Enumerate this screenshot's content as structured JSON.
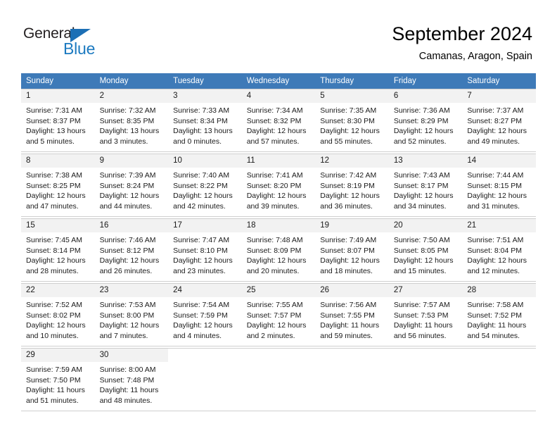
{
  "brand": {
    "name_part1": "General",
    "name_part2": "Blue",
    "triangle_color": "#1c6fb5",
    "blue_color": "#1c7ac0"
  },
  "header": {
    "title": "September 2024",
    "subtitle": "Camanas, Aragon, Spain"
  },
  "theme": {
    "header_bg": "#3e7ab8",
    "header_text": "#ffffff",
    "daynum_bg": "#f2f2f2",
    "grid_line": "#cfcfcf"
  },
  "weekday_headers": [
    "Sunday",
    "Monday",
    "Tuesday",
    "Wednesday",
    "Thursday",
    "Friday",
    "Saturday"
  ],
  "weeks": [
    [
      {
        "day": "1",
        "sunrise": "Sunrise: 7:31 AM",
        "sunset": "Sunset: 8:37 PM",
        "daylight1": "Daylight: 13 hours",
        "daylight2": "and 5 minutes."
      },
      {
        "day": "2",
        "sunrise": "Sunrise: 7:32 AM",
        "sunset": "Sunset: 8:35 PM",
        "daylight1": "Daylight: 13 hours",
        "daylight2": "and 3 minutes."
      },
      {
        "day": "3",
        "sunrise": "Sunrise: 7:33 AM",
        "sunset": "Sunset: 8:34 PM",
        "daylight1": "Daylight: 13 hours",
        "daylight2": "and 0 minutes."
      },
      {
        "day": "4",
        "sunrise": "Sunrise: 7:34 AM",
        "sunset": "Sunset: 8:32 PM",
        "daylight1": "Daylight: 12 hours",
        "daylight2": "and 57 minutes."
      },
      {
        "day": "5",
        "sunrise": "Sunrise: 7:35 AM",
        "sunset": "Sunset: 8:30 PM",
        "daylight1": "Daylight: 12 hours",
        "daylight2": "and 55 minutes."
      },
      {
        "day": "6",
        "sunrise": "Sunrise: 7:36 AM",
        "sunset": "Sunset: 8:29 PM",
        "daylight1": "Daylight: 12 hours",
        "daylight2": "and 52 minutes."
      },
      {
        "day": "7",
        "sunrise": "Sunrise: 7:37 AM",
        "sunset": "Sunset: 8:27 PM",
        "daylight1": "Daylight: 12 hours",
        "daylight2": "and 49 minutes."
      }
    ],
    [
      {
        "day": "8",
        "sunrise": "Sunrise: 7:38 AM",
        "sunset": "Sunset: 8:25 PM",
        "daylight1": "Daylight: 12 hours",
        "daylight2": "and 47 minutes."
      },
      {
        "day": "9",
        "sunrise": "Sunrise: 7:39 AM",
        "sunset": "Sunset: 8:24 PM",
        "daylight1": "Daylight: 12 hours",
        "daylight2": "and 44 minutes."
      },
      {
        "day": "10",
        "sunrise": "Sunrise: 7:40 AM",
        "sunset": "Sunset: 8:22 PM",
        "daylight1": "Daylight: 12 hours",
        "daylight2": "and 42 minutes."
      },
      {
        "day": "11",
        "sunrise": "Sunrise: 7:41 AM",
        "sunset": "Sunset: 8:20 PM",
        "daylight1": "Daylight: 12 hours",
        "daylight2": "and 39 minutes."
      },
      {
        "day": "12",
        "sunrise": "Sunrise: 7:42 AM",
        "sunset": "Sunset: 8:19 PM",
        "daylight1": "Daylight: 12 hours",
        "daylight2": "and 36 minutes."
      },
      {
        "day": "13",
        "sunrise": "Sunrise: 7:43 AM",
        "sunset": "Sunset: 8:17 PM",
        "daylight1": "Daylight: 12 hours",
        "daylight2": "and 34 minutes."
      },
      {
        "day": "14",
        "sunrise": "Sunrise: 7:44 AM",
        "sunset": "Sunset: 8:15 PM",
        "daylight1": "Daylight: 12 hours",
        "daylight2": "and 31 minutes."
      }
    ],
    [
      {
        "day": "15",
        "sunrise": "Sunrise: 7:45 AM",
        "sunset": "Sunset: 8:14 PM",
        "daylight1": "Daylight: 12 hours",
        "daylight2": "and 28 minutes."
      },
      {
        "day": "16",
        "sunrise": "Sunrise: 7:46 AM",
        "sunset": "Sunset: 8:12 PM",
        "daylight1": "Daylight: 12 hours",
        "daylight2": "and 26 minutes."
      },
      {
        "day": "17",
        "sunrise": "Sunrise: 7:47 AM",
        "sunset": "Sunset: 8:10 PM",
        "daylight1": "Daylight: 12 hours",
        "daylight2": "and 23 minutes."
      },
      {
        "day": "18",
        "sunrise": "Sunrise: 7:48 AM",
        "sunset": "Sunset: 8:09 PM",
        "daylight1": "Daylight: 12 hours",
        "daylight2": "and 20 minutes."
      },
      {
        "day": "19",
        "sunrise": "Sunrise: 7:49 AM",
        "sunset": "Sunset: 8:07 PM",
        "daylight1": "Daylight: 12 hours",
        "daylight2": "and 18 minutes."
      },
      {
        "day": "20",
        "sunrise": "Sunrise: 7:50 AM",
        "sunset": "Sunset: 8:05 PM",
        "daylight1": "Daylight: 12 hours",
        "daylight2": "and 15 minutes."
      },
      {
        "day": "21",
        "sunrise": "Sunrise: 7:51 AM",
        "sunset": "Sunset: 8:04 PM",
        "daylight1": "Daylight: 12 hours",
        "daylight2": "and 12 minutes."
      }
    ],
    [
      {
        "day": "22",
        "sunrise": "Sunrise: 7:52 AM",
        "sunset": "Sunset: 8:02 PM",
        "daylight1": "Daylight: 12 hours",
        "daylight2": "and 10 minutes."
      },
      {
        "day": "23",
        "sunrise": "Sunrise: 7:53 AM",
        "sunset": "Sunset: 8:00 PM",
        "daylight1": "Daylight: 12 hours",
        "daylight2": "and 7 minutes."
      },
      {
        "day": "24",
        "sunrise": "Sunrise: 7:54 AM",
        "sunset": "Sunset: 7:59 PM",
        "daylight1": "Daylight: 12 hours",
        "daylight2": "and 4 minutes."
      },
      {
        "day": "25",
        "sunrise": "Sunrise: 7:55 AM",
        "sunset": "Sunset: 7:57 PM",
        "daylight1": "Daylight: 12 hours",
        "daylight2": "and 2 minutes."
      },
      {
        "day": "26",
        "sunrise": "Sunrise: 7:56 AM",
        "sunset": "Sunset: 7:55 PM",
        "daylight1": "Daylight: 11 hours",
        "daylight2": "and 59 minutes."
      },
      {
        "day": "27",
        "sunrise": "Sunrise: 7:57 AM",
        "sunset": "Sunset: 7:53 PM",
        "daylight1": "Daylight: 11 hours",
        "daylight2": "and 56 minutes."
      },
      {
        "day": "28",
        "sunrise": "Sunrise: 7:58 AM",
        "sunset": "Sunset: 7:52 PM",
        "daylight1": "Daylight: 11 hours",
        "daylight2": "and 54 minutes."
      }
    ],
    [
      {
        "day": "29",
        "sunrise": "Sunrise: 7:59 AM",
        "sunset": "Sunset: 7:50 PM",
        "daylight1": "Daylight: 11 hours",
        "daylight2": "and 51 minutes."
      },
      {
        "day": "30",
        "sunrise": "Sunrise: 8:00 AM",
        "sunset": "Sunset: 7:48 PM",
        "daylight1": "Daylight: 11 hours",
        "daylight2": "and 48 minutes."
      },
      {
        "day": "",
        "sunrise": "",
        "sunset": "",
        "daylight1": "",
        "daylight2": ""
      },
      {
        "day": "",
        "sunrise": "",
        "sunset": "",
        "daylight1": "",
        "daylight2": ""
      },
      {
        "day": "",
        "sunrise": "",
        "sunset": "",
        "daylight1": "",
        "daylight2": ""
      },
      {
        "day": "",
        "sunrise": "",
        "sunset": "",
        "daylight1": "",
        "daylight2": ""
      },
      {
        "day": "",
        "sunrise": "",
        "sunset": "",
        "daylight1": "",
        "daylight2": ""
      }
    ]
  ]
}
